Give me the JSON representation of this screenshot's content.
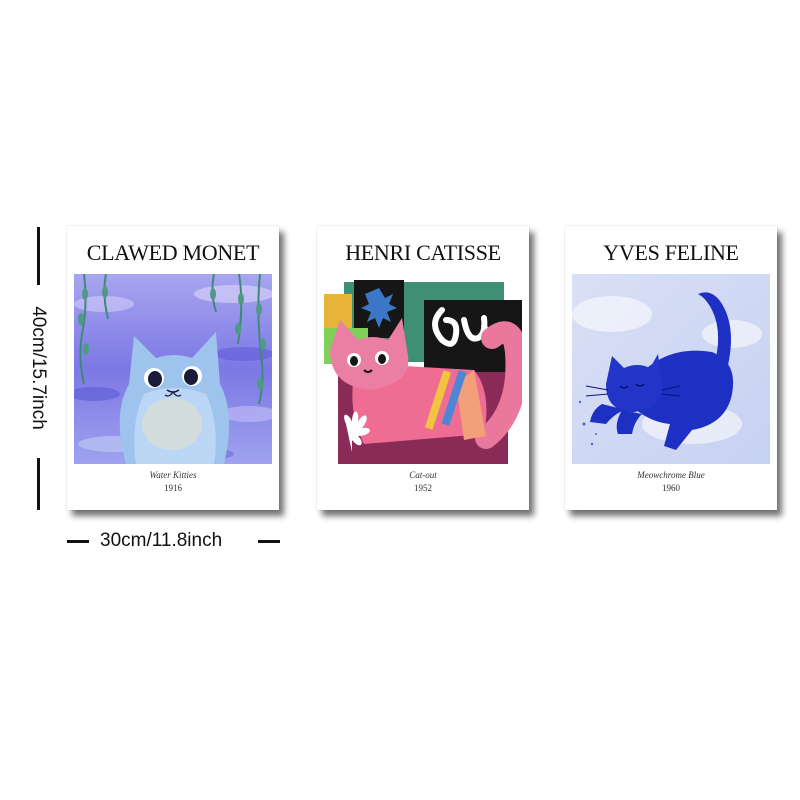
{
  "posters": [
    {
      "title": "CLAWED MONET",
      "caption": "Water Kitties",
      "year": "1916"
    },
    {
      "title": "HENRI CATISSE",
      "caption": "Cat-out",
      "year": "1952"
    },
    {
      "title": "YVES FELINE",
      "caption": "Meowchrome Blue",
      "year": "1960"
    }
  ],
  "dimensions": {
    "height_label": "40cm/15.7inch",
    "width_label": "30cm/11.8inch"
  },
  "colors": {
    "monet_purple": "#7b78e6",
    "matisse_pink": "#e9789c",
    "klein_blue": "#1e2fc4"
  }
}
